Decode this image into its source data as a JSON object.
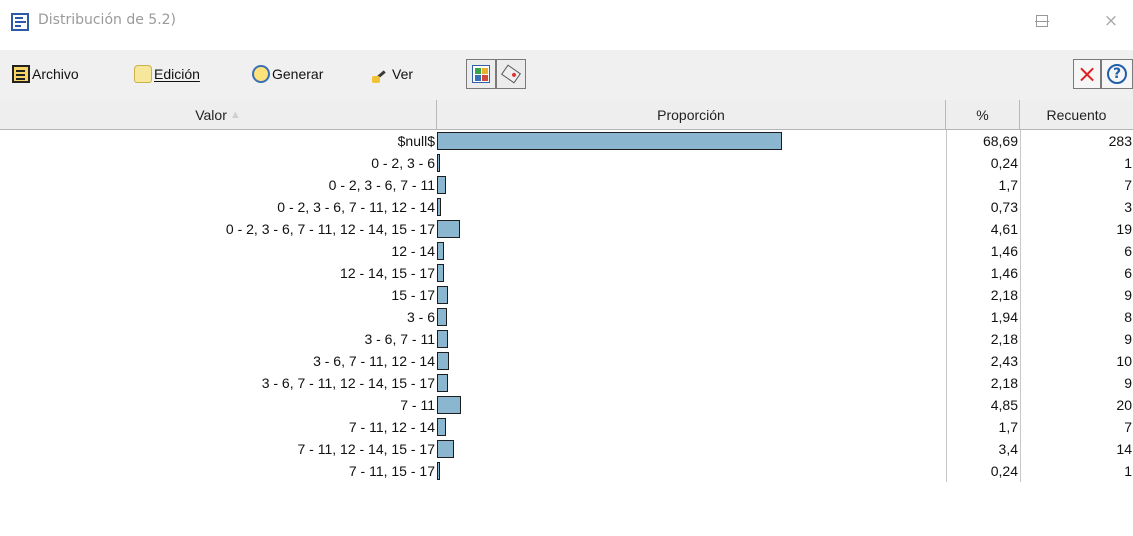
{
  "window": {
    "title": "Distribución de 5.2)",
    "controls": {
      "minimize": "minimize-icon",
      "maximize": "maximize-icon",
      "close": "×"
    }
  },
  "toolbar": {
    "menus": [
      {
        "label": "Archivo",
        "icon": "archivo-icon"
      },
      {
        "label": "Edición",
        "icon": "edicion-icon"
      },
      {
        "label": "Generar",
        "icon": "generar-icon"
      },
      {
        "label": "Ver",
        "icon": "ver-icon"
      }
    ],
    "close_label": "×",
    "help_label": "?"
  },
  "table": {
    "columns": [
      "Valor",
      "Proporción",
      "%",
      "Recuento"
    ],
    "sort_indicator": "▲",
    "bar_color": "#8ab7cf",
    "rows": [
      {
        "valor": "$null$",
        "pct": "68,69",
        "count": "283",
        "proportion": 68.69
      },
      {
        "valor": "0 - 2, 3 - 6",
        "pct": "0,24",
        "count": "1",
        "proportion": 0.24
      },
      {
        "valor": "0 - 2, 3 - 6, 7 - 11",
        "pct": "1,7",
        "count": "7",
        "proportion": 1.7
      },
      {
        "valor": "0 - 2, 3 - 6, 7 - 11, 12 - 14",
        "pct": "0,73",
        "count": "3",
        "proportion": 0.73
      },
      {
        "valor": "0 - 2, 3 - 6, 7 - 11, 12 - 14, 15 - 17",
        "pct": "4,61",
        "count": "19",
        "proportion": 4.61
      },
      {
        "valor": "12 - 14",
        "pct": "1,46",
        "count": "6",
        "proportion": 1.46
      },
      {
        "valor": "12 - 14, 15 - 17",
        "pct": "1,46",
        "count": "6",
        "proportion": 1.46
      },
      {
        "valor": "15 - 17",
        "pct": "2,18",
        "count": "9",
        "proportion": 2.18
      },
      {
        "valor": "3 - 6",
        "pct": "1,94",
        "count": "8",
        "proportion": 1.94
      },
      {
        "valor": "3 - 6, 7 - 11",
        "pct": "2,18",
        "count": "9",
        "proportion": 2.18
      },
      {
        "valor": "3 - 6, 7 - 11, 12 - 14",
        "pct": "2,43",
        "count": "10",
        "proportion": 2.43
      },
      {
        "valor": "3 - 6, 7 - 11, 12 - 14, 15 - 17",
        "pct": "2,18",
        "count": "9",
        "proportion": 2.18
      },
      {
        "valor": "7 - 11",
        "pct": "4,85",
        "count": "20",
        "proportion": 4.85
      },
      {
        "valor": "7 - 11, 12 - 14",
        "pct": "1,7",
        "count": "7",
        "proportion": 1.7
      },
      {
        "valor": "7 - 11, 12 - 14, 15 - 17",
        "pct": "3,4",
        "count": "14",
        "proportion": 3.4
      },
      {
        "valor": "7 - 11, 15 - 17",
        "pct": "0,24",
        "count": "1",
        "proportion": 0.24
      }
    ]
  }
}
